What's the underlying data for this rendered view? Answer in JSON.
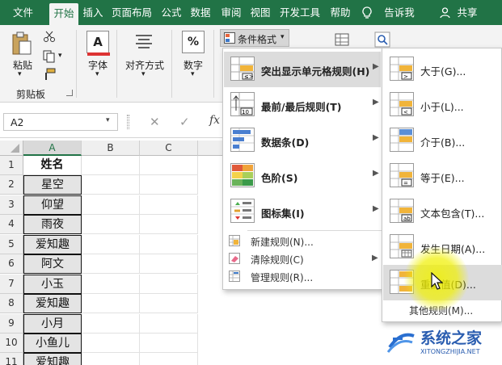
{
  "tabs": [
    "文件",
    "开始",
    "插入",
    "页面布局",
    "公式",
    "数据",
    "审阅",
    "视图",
    "开发工具",
    "帮助",
    "告诉我",
    "共享"
  ],
  "active_tab": "开始",
  "ribbon": {
    "paste_label": "粘贴",
    "clipboard_label": "剪贴板",
    "font_label": "字体",
    "align_label": "对齐方式",
    "number_label": "数字",
    "cond_format_label": "条件格式"
  },
  "formula_bar": {
    "namebox": "A2",
    "fx": "fx"
  },
  "grid": {
    "columns": [
      "A",
      "B",
      "C"
    ],
    "rows": [
      "1",
      "2",
      "3",
      "4",
      "5",
      "6",
      "7",
      "8",
      "9",
      "10",
      "11"
    ],
    "col_a": [
      "姓名",
      "星空",
      "仰望",
      "雨夜",
      "爱知趣",
      "阿文",
      "小玉",
      "爱知趣",
      "小月",
      "小鱼儿",
      "爱知趣"
    ]
  },
  "cond_menu": {
    "items": [
      {
        "label": "突出显示单元格规则(H)"
      },
      {
        "label": "最前/最后规则(T)"
      },
      {
        "label": "数据条(D)"
      },
      {
        "label": "色阶(S)"
      },
      {
        "label": "图标集(I)"
      }
    ],
    "small_items": [
      {
        "label": "新建规则(N)..."
      },
      {
        "label": "清除规则(C)"
      },
      {
        "label": "管理规则(R)..."
      }
    ]
  },
  "sub_menu": {
    "items": [
      {
        "label": "大于(G)..."
      },
      {
        "label": "小于(L)..."
      },
      {
        "label": "介于(B)..."
      },
      {
        "label": "等于(E)..."
      },
      {
        "label": "文本包含(T)..."
      },
      {
        "label": "发生日期(A)..."
      },
      {
        "label": "重复值(D)..."
      }
    ],
    "other": "其他规则(M)..."
  },
  "watermark": {
    "title": "系统之家",
    "url": "XITONGZHIJIA.NET"
  },
  "colors": {
    "excel_green": "#217346",
    "highlight": "#dcdcdc",
    "cursor_glow": "#f2f200"
  }
}
